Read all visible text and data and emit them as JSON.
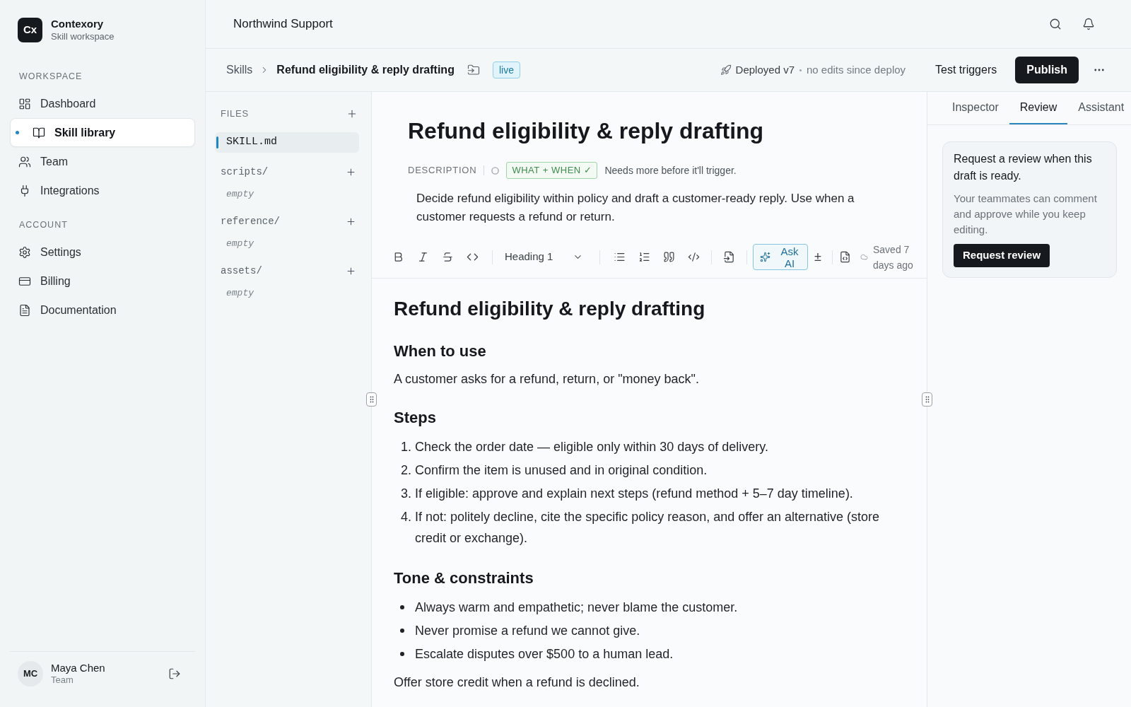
{
  "sidebar": {
    "brand": {
      "logo": "Cx",
      "name": "Contexory",
      "subtitle": "Skill workspace"
    },
    "sections": [
      {
        "title": "WORKSPACE",
        "items": [
          {
            "label": "Dashboard",
            "selected": false
          },
          {
            "label": "Skill library",
            "selected": true
          },
          {
            "label": "Team",
            "selected": false
          },
          {
            "label": "Integrations",
            "selected": false
          }
        ]
      },
      {
        "title": "ACCOUNT",
        "items": [
          {
            "label": "Settings",
            "selected": false
          },
          {
            "label": "Billing",
            "selected": false
          },
          {
            "label": "Documentation",
            "selected": false
          }
        ]
      }
    ],
    "user": {
      "initials": "MC",
      "name": "Maya Chen",
      "role": "Team"
    }
  },
  "header": {
    "title": "Northwind Support"
  },
  "breadcrumb": {
    "items": [
      "Skills",
      "Refund eligibility & reply drafting"
    ],
    "status": "live",
    "deploy": {
      "version": "Deployed v7",
      "note": "no edits since deploy"
    },
    "actions": [
      {
        "label": "Test triggers",
        "kind": "ghost"
      },
      {
        "label": "Publish",
        "kind": "primary"
      }
    ]
  },
  "files": {
    "title": "FILES",
    "entries": [
      {
        "kind": "file",
        "name": "SKILL.md",
        "selected": true
      },
      {
        "kind": "folder",
        "name": "scripts/",
        "note": "empty",
        "selected": false
      },
      {
        "kind": "folder",
        "name": "reference/",
        "note": "empty",
        "selected": false
      },
      {
        "kind": "folder",
        "name": "assets/",
        "note": "empty",
        "selected": false
      }
    ]
  },
  "editor": {
    "title": "Refund eligibility & reply drafting",
    "description": {
      "label": "DESCRIPTION",
      "check": "WHAT + WHEN ✓",
      "hint": "Needs more before it'll trigger.",
      "text": "Decide refund eligibility within policy and draft a customer-ready reply. Use when a customer requests a refund or return."
    },
    "toolbar": {
      "block_style": "Heading 1",
      "ask_ai": "Ask AI",
      "sign": "±",
      "saved": "Saved 7 days ago"
    },
    "document": [
      {
        "kind": "h1",
        "text": "Refund eligibility & reply drafting"
      },
      {
        "kind": "h2",
        "text": "When to use"
      },
      {
        "kind": "p",
        "text": "A customer asks for a refund, return, or \"money back\"."
      },
      {
        "kind": "h2",
        "text": "Steps"
      },
      {
        "kind": "ol",
        "items": [
          {
            "marker": "1.",
            "text": "Check the order date — eligible only within 30 days of delivery."
          },
          {
            "marker": "2.",
            "text": "Confirm the item is unused and in original condition."
          },
          {
            "marker": "3.",
            "text": "If eligible: approve and explain next steps (refund method + 5–7 day timeline)."
          },
          {
            "marker": "4.",
            "text": "If not: politely decline, cite the specific policy reason, and offer an alternative (store credit or exchange)."
          }
        ]
      },
      {
        "kind": "h2",
        "text": "Tone & constraints"
      },
      {
        "kind": "ul",
        "items": [
          {
            "text": "Always warm and empathetic; never blame the customer."
          },
          {
            "text": "Never promise a refund we cannot give."
          },
          {
            "text": "Escalate disputes over $500 to a human lead."
          }
        ]
      },
      {
        "kind": "p",
        "text": "Offer store credit when a refund is declined."
      }
    ]
  },
  "inspector": {
    "tabs": [
      {
        "label": "Inspector",
        "selected": false
      },
      {
        "label": "Review",
        "selected": true
      },
      {
        "label": "Assistant",
        "selected": false
      }
    ],
    "review": {
      "title": "Request a review when this draft is ready.",
      "body": "Your teammates can comment and approve while you keep editing.",
      "button": "Request review"
    }
  }
}
